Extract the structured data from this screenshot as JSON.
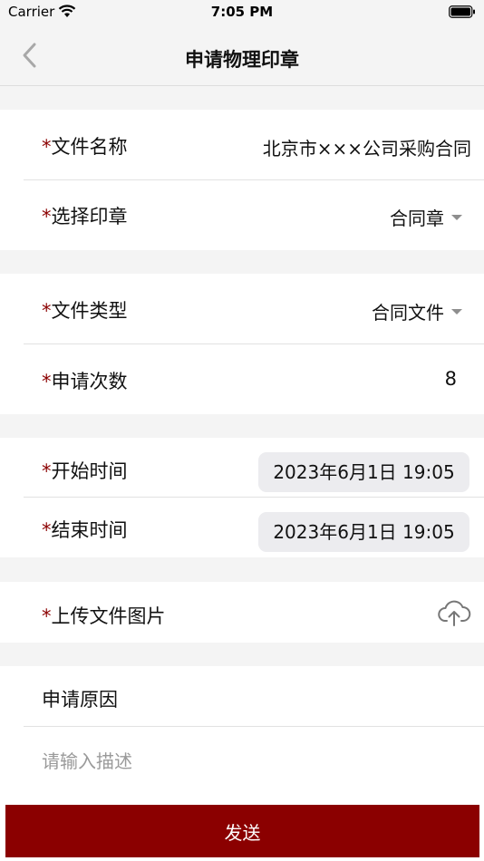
{
  "status_bar": {
    "carrier": "Carrier",
    "time": "7:05 PM"
  },
  "nav": {
    "title": "申请物理印章"
  },
  "form": {
    "required_mark": "*",
    "file_name": {
      "label": "文件名称",
      "value": "北京市×××公司采购合同"
    },
    "seal": {
      "label": "选择印章",
      "value": "合同章"
    },
    "file_type": {
      "label": "文件类型",
      "value": "合同文件"
    },
    "apply_count": {
      "label": "申请次数",
      "value": "8"
    },
    "start_time": {
      "label": "开始时间",
      "value": "2023年6月1日 19:05"
    },
    "end_time": {
      "label": "结束时间",
      "value": "2023年6月1日 19:05"
    },
    "upload": {
      "label": "上传文件图片"
    },
    "reason": {
      "label": "申请原因",
      "placeholder": "请输入描述"
    }
  },
  "submit": {
    "label": "发送"
  },
  "colors": {
    "accent": "#8b0000",
    "background": "#f4f4f4",
    "pill": "#ececef"
  },
  "icons": [
    "back-chevron-icon",
    "wifi-icon",
    "battery-icon",
    "caret-down-icon",
    "cloud-upload-icon"
  ]
}
